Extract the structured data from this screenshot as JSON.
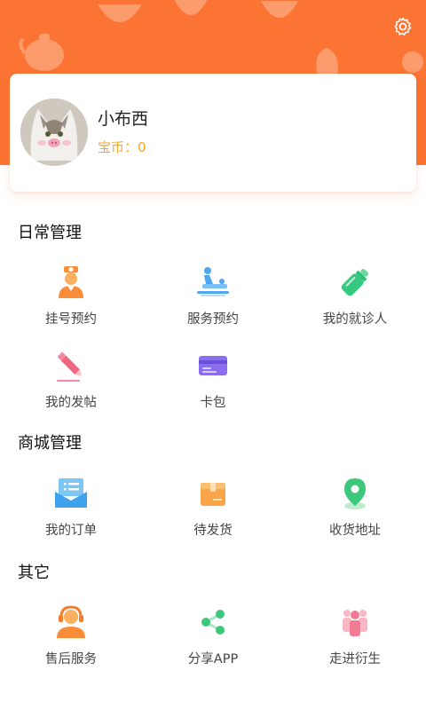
{
  "colors": {
    "accent": "#fb7433",
    "coin": "#f5a623"
  },
  "header": {
    "settings_icon": "gear-icon"
  },
  "profile": {
    "name": "小布西",
    "coins": "宝币：0",
    "avatar_icon": "cat-avatar"
  },
  "sections": {
    "daily": {
      "title": "日常管理",
      "items": [
        {
          "label": "挂号预约",
          "icon": "nurse-icon"
        },
        {
          "label": "服务预约",
          "icon": "massage-icon"
        },
        {
          "label": "我的就诊人",
          "icon": "baby-bottle-icon"
        },
        {
          "label": "我的发帖",
          "icon": "pencil-icon"
        },
        {
          "label": "卡包",
          "icon": "card-icon"
        }
      ]
    },
    "mall": {
      "title": "商城管理",
      "items": [
        {
          "label": "我的订单",
          "icon": "order-icon"
        },
        {
          "label": "待发货",
          "icon": "box-icon"
        },
        {
          "label": "收货地址",
          "icon": "location-icon"
        }
      ]
    },
    "other": {
      "title": "其它",
      "items": [
        {
          "label": "售后服务",
          "icon": "headset-icon"
        },
        {
          "label": "分享APP",
          "icon": "share-icon"
        },
        {
          "label": "走进衍生",
          "icon": "team-icon"
        }
      ]
    }
  }
}
